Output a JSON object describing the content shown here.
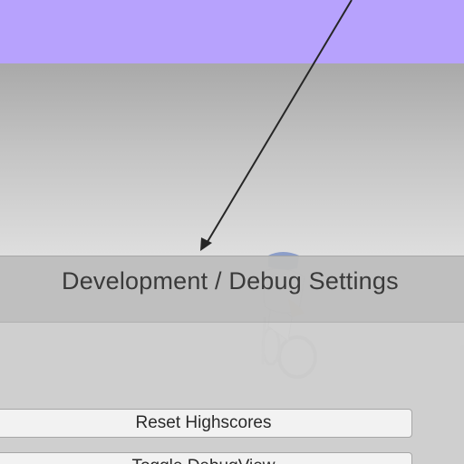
{
  "panel": {
    "title": "Development / Debug Settings"
  },
  "buttons": {
    "reset_highscores": "Reset Highscores",
    "toggle_debug_view": "Toggle DebugView"
  },
  "colors": {
    "sky": "#b7a2fd",
    "panel": "#cecece",
    "button_bg": "#f2f2f2"
  }
}
